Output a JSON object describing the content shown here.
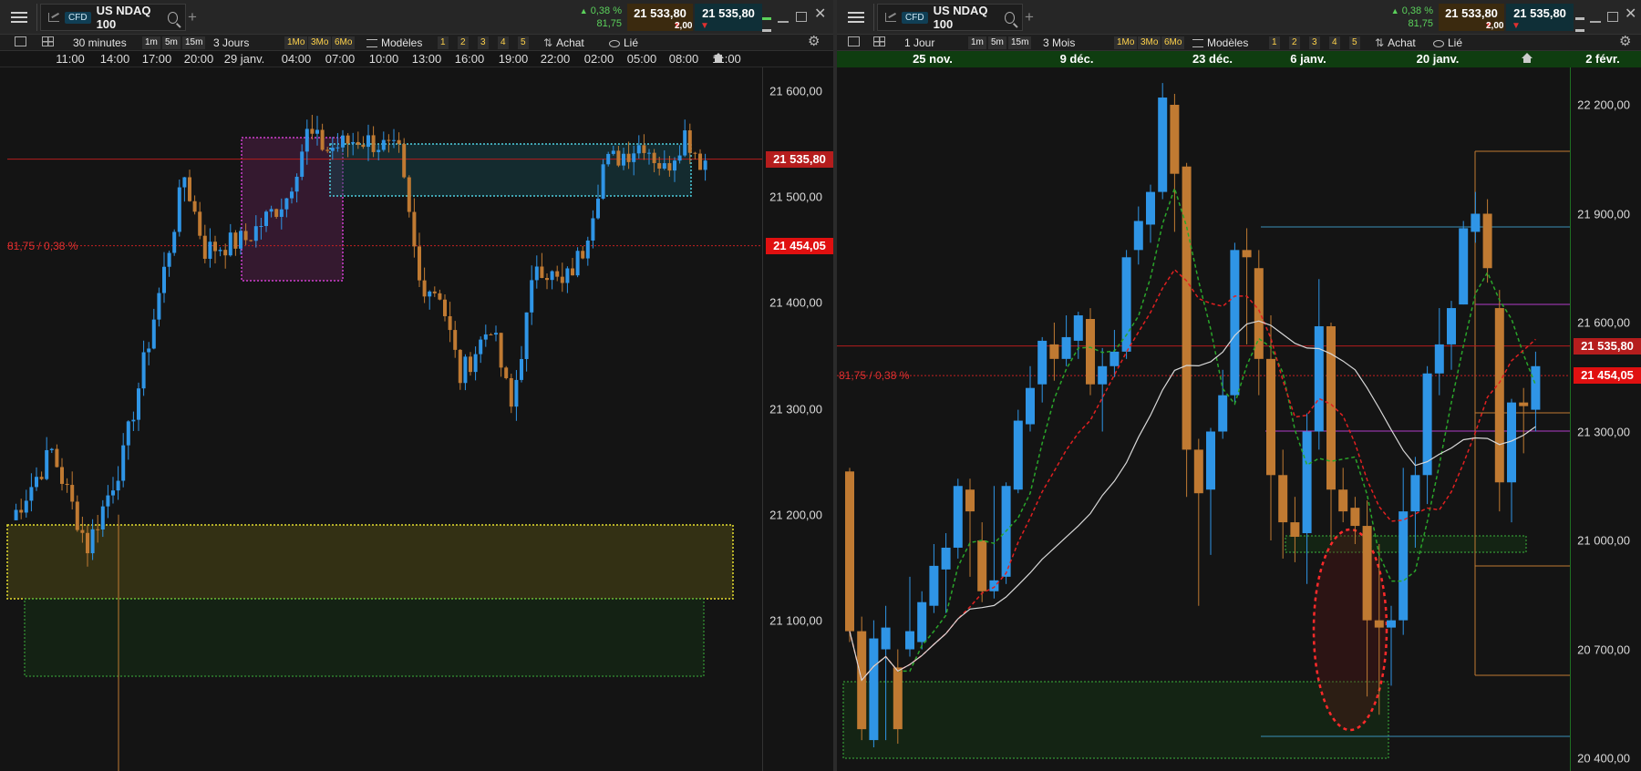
{
  "left": {
    "tab": {
      "badge": "CFD",
      "title": "US NDAQ 100"
    },
    "quote": {
      "change_pct": "0,38 %",
      "change_pts": "81,75",
      "bid": "21 533,80",
      "ask": "21 535,80",
      "spread": "2,00"
    },
    "toolbar": {
      "interval": "30 minutes",
      "quick_intervals": [
        "1m",
        "5m",
        "15m"
      ],
      "period": "3 Jours",
      "quick_periods": [
        "1Mo",
        "3Mo",
        "6Mo"
      ],
      "templates": "Modèles",
      "layouts": [
        "1",
        "2",
        "3",
        "4",
        "5"
      ],
      "buy": "Achat",
      "linked": "Lié"
    },
    "x_axis": [
      "11:00",
      "14:00",
      "17:00",
      "20:00",
      "29 janv.",
      "04:00",
      "07:00",
      "10:00",
      "13:00",
      "16:00",
      "19:00",
      "22:00",
      "02:00",
      "05:00",
      "08:00",
      "11:00"
    ],
    "y_axis": [
      "21 600,00",
      "21 500,00",
      "21 400,00",
      "21 300,00",
      "21 200,00",
      "21 100,00"
    ],
    "current_price": "21 535,80",
    "ref_price": "21 454,05",
    "change_label": "81,75 / 0,38 %"
  },
  "right": {
    "tab": {
      "badge": "CFD",
      "title": "US NDAQ 100"
    },
    "quote": {
      "change_pct": "0,38 %",
      "change_pts": "81,75",
      "bid": "21 533,80",
      "ask": "21 535,80",
      "spread": "2,00"
    },
    "toolbar": {
      "interval": "1 Jour",
      "quick_intervals": [
        "1m",
        "5m",
        "15m"
      ],
      "period": "3 Mois",
      "quick_periods": [
        "1Mo",
        "3Mo",
        "6Mo"
      ],
      "templates": "Modèles",
      "layouts": [
        "1",
        "2",
        "3",
        "4",
        "5"
      ],
      "buy": "Achat",
      "linked": "Lié"
    },
    "x_axis": [
      "25 nov.",
      "9 déc.",
      "23 déc.",
      "6 janv.",
      "20 janv.",
      "2 févr."
    ],
    "y_axis": [
      "22 200,00",
      "21 900,00",
      "21 600,00",
      "21 300,00",
      "21 000,00",
      "20 700,00",
      "20 400,00"
    ],
    "current_price": "21 535,80",
    "ref_price": "21 454,05",
    "change_label": "81,75 / 0,38 %"
  },
  "colors": {
    "bull": "#2f95e6",
    "bear": "#c07a32",
    "up": "#5bd15b",
    "down": "#e03030",
    "price_line": "#b51d1d"
  }
}
